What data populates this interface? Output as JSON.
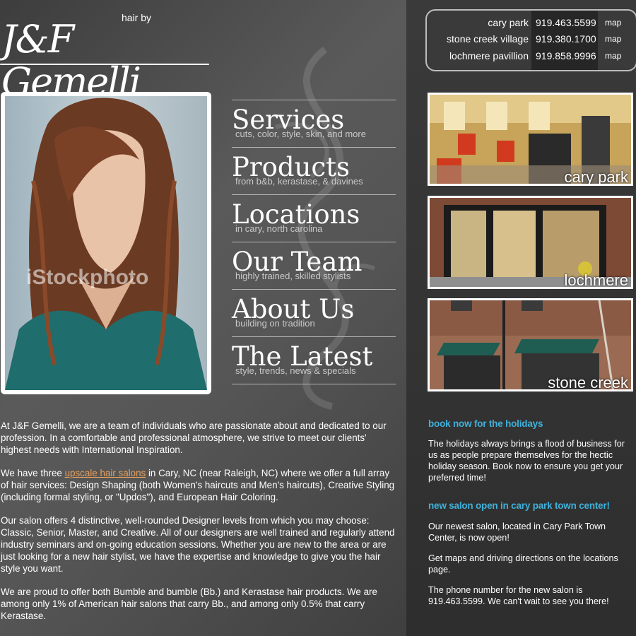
{
  "logo": {
    "small": "hair by",
    "main": "J&F Gemelli"
  },
  "locations": [
    {
      "name": "cary park",
      "phone": "919.463.5599",
      "map": "map"
    },
    {
      "name": "stone creek village",
      "phone": "919.380.1700",
      "map": "map"
    },
    {
      "name": "lochmere pavillion",
      "phone": "919.858.9996",
      "map": "map"
    }
  ],
  "photo": {
    "watermark": "iStockphoto"
  },
  "nav": [
    {
      "title": "Services",
      "sub": "cuts, color, style, skin, and more"
    },
    {
      "title": "Products",
      "sub": "from b&b, kerastase, & davines"
    },
    {
      "title": "Locations",
      "sub": "in cary, north carolina"
    },
    {
      "title": "Our Team",
      "sub": "highly trained, skilled stylists"
    },
    {
      "title": "About Us",
      "sub": "building on tradition"
    },
    {
      "title": "The Latest",
      "sub": "style, trends, news & specials"
    }
  ],
  "thumbs": [
    {
      "label": "cary park"
    },
    {
      "label": "lochmere"
    },
    {
      "label": "stone creek"
    }
  ],
  "main": {
    "p1": "At J&F Gemelli, we are a team of individuals who are passionate about and dedicated to our profession. In a comfortable and professional atmosphere, we strive to meet our clients' highest needs with International Inspiration.",
    "p2_before": "We have three ",
    "p2_link": "upscale hair salons",
    "p2_after": " in Cary, NC (near Raleigh, NC) where we offer a full array of hair services: Design Shaping (both Women's haircuts and Men's haircuts), Creative Styling (including formal styling, or \"Updos\"), and European Hair Coloring.",
    "p3": "Our salon offers 4 distinctive, well-rounded Designer levels from which you may choose: Classic, Senior, Master, and Creative.  All of our designers are well trained and regularly attend industry seminars and on-going education sessions. Whether you are new to the area or are just looking for a new hair stylist, we have the expertise and knowledge to give you the hair style you want.",
    "p4": "We are proud to offer both Bumble and bumble (Bb.) and Kerastase hair products. We are among only 1% of American hair salons that carry Bb., and among only 0.5% that carry Kerastase."
  },
  "news": {
    "h1": "book now for the holidays",
    "p1": "The holidays always brings a flood of business for us as people prepare themselves for the hectic holiday season.  Book now to ensure you get your preferred time!",
    "h2": "new salon open in cary park town center!",
    "p2": "Our newest salon, located in Cary Park Town Center, is now open!",
    "p3": "Get maps and driving directions on the locations page.",
    "p4": "The phone number for the new salon is 919.463.5599. We can't wait to see you there!"
  },
  "colors": {
    "accent_blue": "#3fb0d9",
    "link_orange": "#e8a15a"
  }
}
